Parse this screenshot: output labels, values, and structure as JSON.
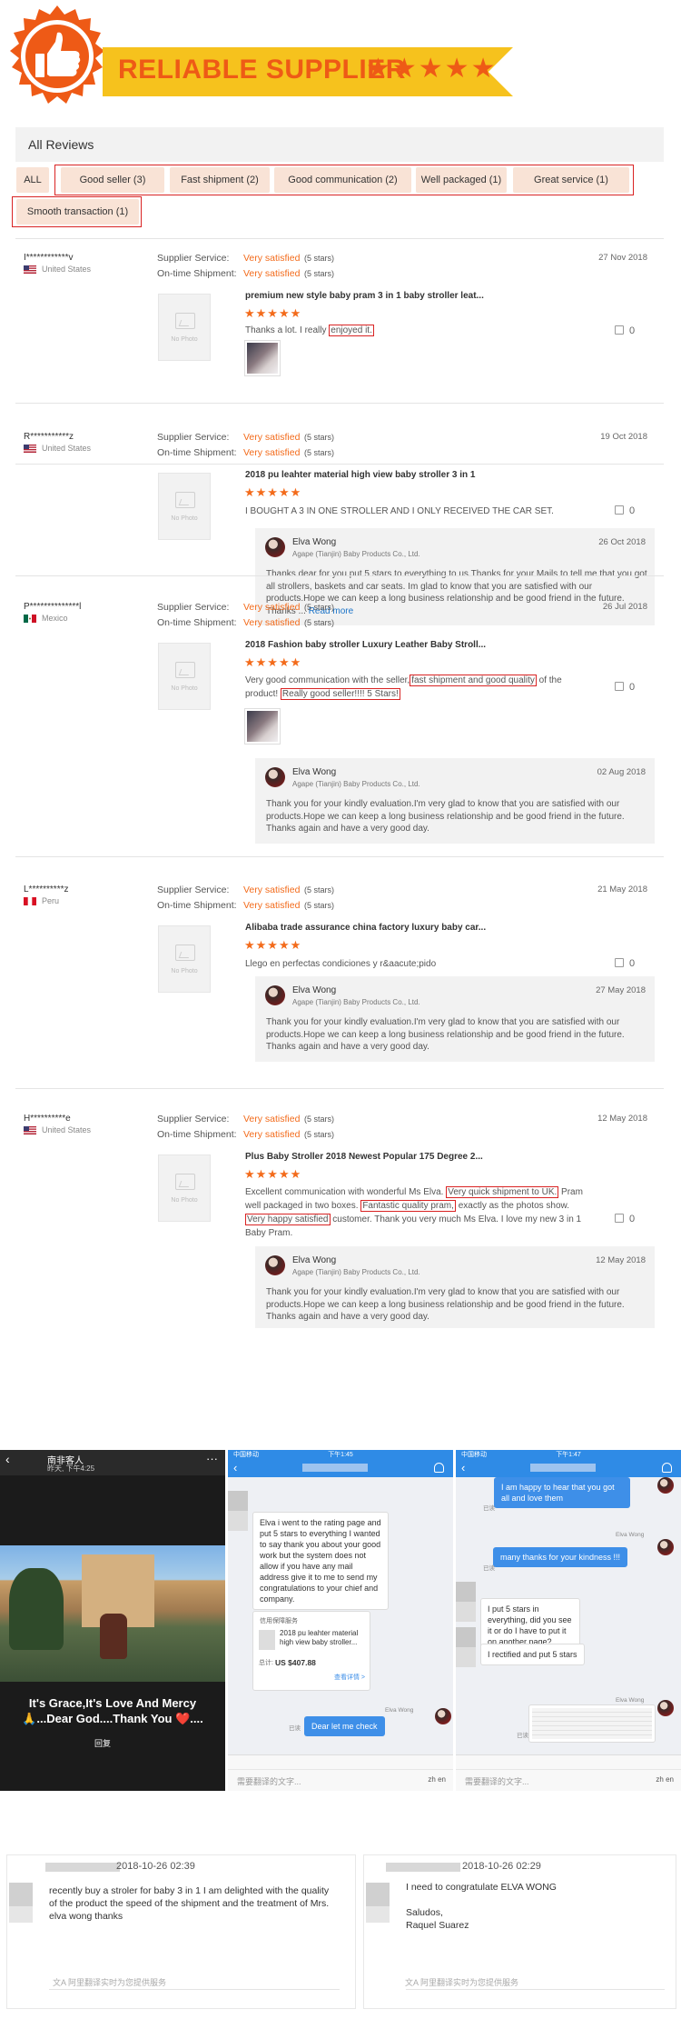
{
  "header": {
    "title": "RELIABLE SUPPLIER",
    "stars": "★★★★★",
    "colors": {
      "orange": "#ee5a16",
      "gold": "#f6c21d"
    }
  },
  "reviews_panel": {
    "heading": "All Reviews",
    "filters": [
      "ALL",
      "Good seller (3)",
      "Fast shipment (2)",
      "Good communication (2)",
      "Well packaged (1)",
      "Great service (1)",
      "Smooth transaction (1)"
    ],
    "labels": {
      "supplier_service": "Supplier Service:",
      "ontime_shipment": "On-time Shipment:",
      "satisfied": "Very satisfied",
      "five_stars": "(5 stars)",
      "no_photo": "No Photo",
      "like_count": "0",
      "product_stars": "★★★★★"
    },
    "reviews": [
      {
        "name": "I************v",
        "country": "United States",
        "date": "27 Nov 2018",
        "product": "premium new style baby pram 3 in 1 baby stroller leat...",
        "text_a": "Thanks a lot. I really ",
        "text_hl": "enjoyed it."
      },
      {
        "name": "R***********z",
        "country": "United States",
        "date": "19 Oct 2018",
        "product": "2018 pu leahter material high view baby stroller 3 in 1",
        "text": "I BOUGHT A 3 IN ONE STROLLER AND I ONLY RECEIVED THE CAR SET.",
        "reply": {
          "name": "Elva Wong",
          "company": "Agape (Tianjin) Baby Products Co., Ltd.",
          "date": "26 Oct 2018",
          "text": "Thanks dear for you put 5 stars to everything to us.Thanks for your Mails to tell me that you got all strollers, baskets and car seats. Im glad to know that you are satisfied with our products.Hope we can keep a long business relationship and be good friend in the future. Thanks ...",
          "more": "Read more"
        }
      },
      {
        "name": "P**************l",
        "country": "Mexico",
        "date": "26 Jul 2018",
        "product": "2018 Fashion baby stroller Luxury Leather Baby Stroll...",
        "text_a": "Very good communication with the seller,",
        "text_hl1": "fast shipment and good quality",
        "text_b": " of the product!",
        "text_hl2": "Really good seller!!!! 5 Stars!",
        "reply": {
          "name": "Elva Wong",
          "company": "Agape (Tianjin) Baby Products Co., Ltd.",
          "date": "02 Aug 2018",
          "text": "Thank you for your kindly evaluation.I'm very glad to know that you are satisfied with our products.Hope we can keep a long business relationship and be good friend in the future. Thanks again and have a very good day."
        }
      },
      {
        "name": "L**********z",
        "country": "Peru",
        "date": "21 May 2018",
        "product": "Alibaba trade assurance china factory luxury baby car...",
        "text": "Llego en perfectas condiciones y r&aacute;pido",
        "reply": {
          "name": "Elva Wong",
          "company": "Agape (Tianjin) Baby Products Co., Ltd.",
          "date": "27 May 2018",
          "text": "Thank you for your kindly evaluation.I'm very glad to know that you are satisfied with our products.Hope we can keep a long business relationship and be good friend in the future. Thanks again and have a very good day."
        }
      },
      {
        "name": "H**********e",
        "country": "United States",
        "date": "12 May 2018",
        "product": "Plus Baby Stroller 2018 Newest Popular 175 Degree 2...",
        "text_a": "Excellent communication with wonderful Ms Elva.",
        "text_hl1": "Very quick shipment to UK.",
        "text_b": " Pram well packaged in two boxes.",
        "text_hl2": "Fantastic quality pram,",
        "text_c": " exactly as the photos show.",
        "text_hl3": "Very happy satisfied",
        "text_d": " customer. Thank you very much Ms Elva. I love my new 3 in 1 Baby Pram.",
        "reply": {
          "name": "Elva Wong",
          "company": "Agape (Tianjin) Baby Products Co., Ltd.",
          "date": "12 May 2018",
          "text": "Thank you for your kindly evaluation.I'm very glad to know that you are satisfied with our products.Hope we can keep a long business relationship and be good friend in the future. Thanks again and have a very good day."
        }
      }
    ]
  },
  "screenshot_1": {
    "name": "南非客人",
    "ago": "昨天, 下午4:25",
    "caption": "It's Grace,It's Love And Mercy 🙏...Dear God....Thank You ❤️....",
    "return": "回复"
  },
  "screenshot_2": {
    "time": "下午1:45",
    "carrier": "中国移动",
    "msg1": "Elva i went to the rating page and put 5 stars to everything I wanted to say thank you about your good work but the system does not allow if you have any mail address give it to me to send my congratulations to your chief and company.",
    "card_title": "信用保障服务",
    "card_product": "2018 pu leahter material high view baby stroller...",
    "card_total_label": "总计:",
    "card_total": "US $407.88",
    "card_link": "查看详情 >",
    "sender": "Elva Wong",
    "read": "已读",
    "reply": "Dear let me check",
    "input_placeholder": "需要翻译的文字...",
    "lang": "zh  en"
  },
  "screenshot_3": {
    "time": "下午1:47",
    "carrier": "中国移动",
    "msg1": "I am happy to hear that you got all and love them",
    "sender": "Elva Wong",
    "read": "已读",
    "msg2": "many thanks for your kindness !!!",
    "msg3": "I put 5 stars in everything, did you see it or do I have to put it on another page?",
    "msg4": "I rectified and put 5 stars",
    "input_placeholder": "需要翻译的文字...",
    "lang": "zh  en"
  },
  "bottom_messages": [
    {
      "date": "2018-10-26 02:39",
      "text": "recently buy a stroler for baby 3 in 1 I am delighted with the quality of the product the speed of the shipment and the treatment of Mrs. elva wong thanks",
      "translate": "阿里翻译实时为您提供服务"
    },
    {
      "date": "2018-10-26 02:29",
      "text": "I need to congratulate ELVA WONG\n\nSaludos,\nRaquel Suarez",
      "translate": "阿里翻译实时为您提供服务"
    }
  ]
}
